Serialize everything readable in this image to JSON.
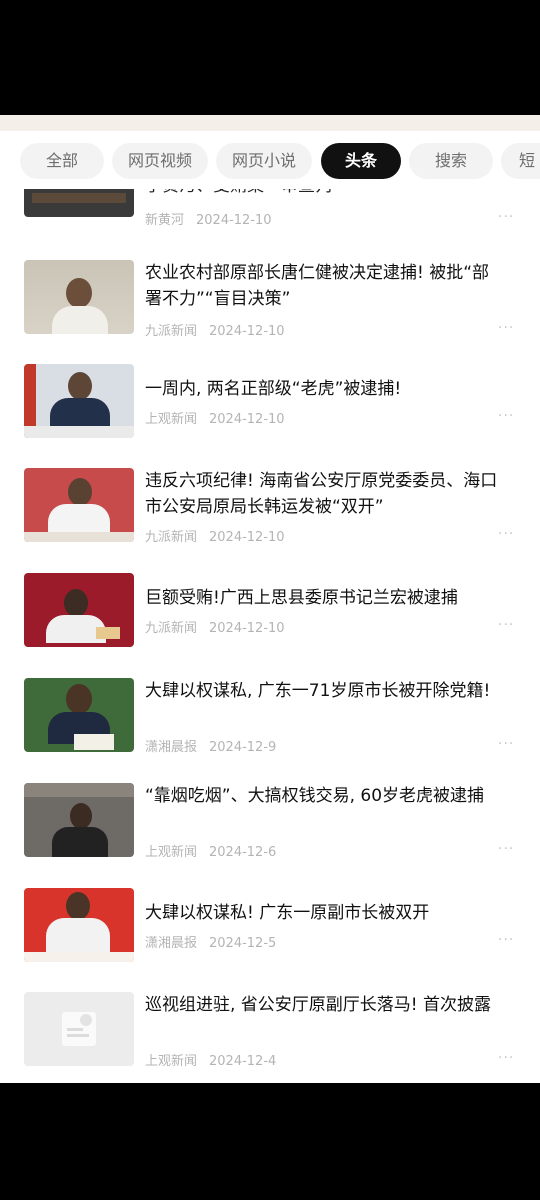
{
  "tabs": [
    {
      "label": "全部"
    },
    {
      "label": "网页视频"
    },
    {
      "label": "网页小说"
    },
    {
      "label": "头条",
      "active": true
    },
    {
      "label": "搜索"
    },
    {
      "label": "短"
    }
  ],
  "partial_item": {
    "title": "了贪污、受贿案一审宣判",
    "source": "新黄河",
    "date": "2024-12-10",
    "more": "···"
  },
  "articles": [
    {
      "title": "农业农村部原部长唐仁健被决定逮捕! 被批“部署不力”“盲目决策”",
      "source": "九派新闻",
      "date": "2024-12-10",
      "more": "···"
    },
    {
      "title": "一周内, 两名正部级“老虎”被逮捕!",
      "source": "上观新闻",
      "date": "2024-12-10",
      "more": "···"
    },
    {
      "title": "违反六项纪律! 海南省公安厅原党委委员、海口市公安局原局长韩运发被“双开”",
      "source": "九派新闻",
      "date": "2024-12-10",
      "more": "···"
    },
    {
      "title": "巨额受贿!广西上思县委原书记兰宏被逮捕",
      "source": "九派新闻",
      "date": "2024-12-10",
      "more": "···"
    },
    {
      "title": "大肆以权谋私, 广东一71岁原市长被开除党籍!",
      "source": "潇湘晨报",
      "date": "2024-12-9",
      "more": "···"
    },
    {
      "title": "“靠烟吃烟”、大搞权钱交易, 60岁老虎被逮捕",
      "source": "上观新闻",
      "date": "2024-12-6",
      "more": "···"
    },
    {
      "title": "大肆以权谋私! 广东一原副市长被双开",
      "source": "潇湘晨报",
      "date": "2024-12-5",
      "more": "···"
    },
    {
      "title": "巡视组进驻, 省公安厅原副厅长落马! 首次披露",
      "source": "上观新闻",
      "date": "2024-12-4",
      "more": "···"
    }
  ],
  "colors": {
    "active_tab_bg": "#111111",
    "tab_bg": "#f3f3f3",
    "meta_text": "#b4b4b4"
  }
}
